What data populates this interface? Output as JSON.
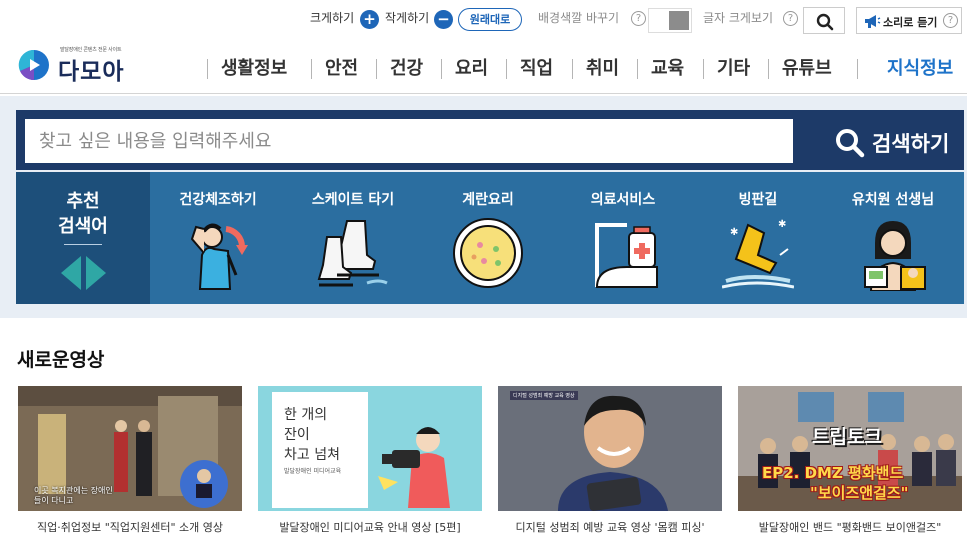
{
  "util_bar": {
    "zoom_in_label": "크게하기",
    "zoom_out_label": "작게하기",
    "zoom_in_symbol": "+",
    "zoom_out_symbol": "−",
    "original_label": "원래대로",
    "bg_color_label": "배경색깔 바꾸기",
    "text_large_label": "글자 크게보기",
    "voice_label": "소리로 듣기",
    "help_symbol": "?"
  },
  "header": {
    "logo_subtitle": "발달장애인 콘텐츠 전문 사이트",
    "logo_name": "다모아",
    "nav": [
      "생활정보",
      "안전",
      "건강",
      "요리",
      "직업",
      "취미",
      "교육",
      "기타",
      "유튜브"
    ],
    "nav_accent": "지식정보"
  },
  "search": {
    "placeholder": "찾고 싶은 내용을 입력해주세요",
    "button_label": "검색하기"
  },
  "recommend": {
    "label_line1": "추천",
    "label_line2": "검색어",
    "items": [
      {
        "label": "건강체조하기",
        "icon": "stretching-icon"
      },
      {
        "label": "스케이트 타기",
        "icon": "skate-icon"
      },
      {
        "label": "계란요리",
        "icon": "egg-dish-icon"
      },
      {
        "label": "의료서비스",
        "icon": "iv-drip-icon"
      },
      {
        "label": "빙판길",
        "icon": "icy-road-boot-icon"
      },
      {
        "label": "유치원 선생님",
        "icon": "teacher-icon"
      }
    ]
  },
  "videos_section": {
    "title": "새로운영상",
    "items": [
      {
        "caption": "직업·취업정보 \"직업지원센터\" 소개 영상",
        "overlay": "이곳 복지관에는 장애인들이 다니고"
      },
      {
        "caption": "발달장애인 미디어교육 안내 영상 [5편]",
        "overlay_line1": "한 개의",
        "overlay_line2": "잔이",
        "overlay_line3": "차고 넘쳐",
        "overlay_small": "발달장애인 미디어교육"
      },
      {
        "caption": "디지털 성범죄 예방 교육 영상 '몸캠 피싱'",
        "overlay": "디지털 성범죄 예방 교육 영상"
      },
      {
        "caption": "발달장애인 밴드 \"평화밴드 보이앤걸즈\"",
        "overlay_line1": "트립토크",
        "overlay_line2": "EP2. DMZ 평화밴드",
        "overlay_line3": "\"보이즈앤걸즈\""
      }
    ]
  },
  "colors": {
    "brand_blue": "#1e66b8",
    "search_navy": "#1d3a68",
    "recommend_blue": "#2b6ea0",
    "accent_teal": "#2fa7a5"
  }
}
